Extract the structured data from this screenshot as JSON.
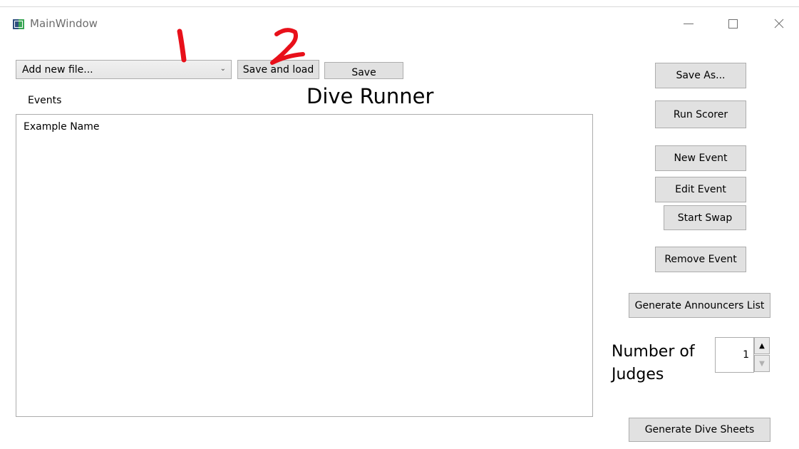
{
  "window": {
    "title": "MainWindow"
  },
  "toolbar": {
    "file_combo_value": "Add new file...",
    "save_and_load_label": "Save and load",
    "save_label": "Save"
  },
  "main": {
    "events_label": "Events",
    "heading": "Dive Runner",
    "events_list": [
      "Example Name"
    ]
  },
  "sidebar": {
    "save_as_label": "Save As...",
    "run_scorer_label": "Run Scorer",
    "new_event_label": "New Event",
    "edit_event_label": "Edit Event",
    "start_swap_label": "Start Swap",
    "remove_event_label": "Remove Event",
    "gen_announcers_label": "Generate Announcers List",
    "judges_label": "Number of Judges",
    "judges_value": "1",
    "gen_sheets_label": "Generate Dive Sheets"
  },
  "annotations": {
    "mark_1": "1",
    "mark_2": "2",
    "color": "#e8101a"
  },
  "icons": [
    "app-icon",
    "minimize-icon",
    "maximize-icon",
    "close-icon",
    "chevron-down-icon",
    "spin-up-icon",
    "spin-down-icon"
  ]
}
